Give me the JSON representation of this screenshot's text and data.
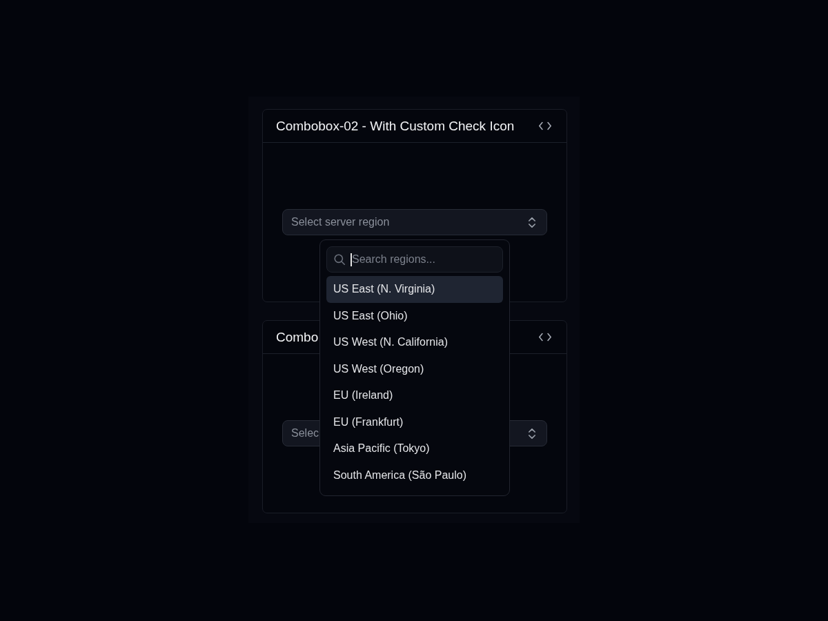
{
  "cards": [
    {
      "title": "Combobox-02 - With Custom Check Icon",
      "combobox": {
        "placeholder": "Select server region",
        "expanded": true,
        "search": {
          "placeholder": "Search regions...",
          "focused": true
        },
        "options": [
          {
            "label": "US East (N. Virginia)",
            "highlighted": true,
            "selected": false
          },
          {
            "label": "US East (Ohio)",
            "highlighted": false,
            "selected": false
          },
          {
            "label": "US West (N. California)",
            "highlighted": false,
            "selected": false
          },
          {
            "label": "US West (Oregon)",
            "highlighted": false,
            "selected": false
          },
          {
            "label": "EU (Ireland)",
            "highlighted": false,
            "selected": false
          },
          {
            "label": "EU (Frankfurt)",
            "highlighted": false,
            "selected": false
          },
          {
            "label": "Asia Pacific (Tokyo)",
            "highlighted": false,
            "selected": false
          },
          {
            "label": "South America (São Paulo)",
            "highlighted": false,
            "selected": false
          }
        ]
      }
    },
    {
      "title": "Combo",
      "combobox": {
        "placeholder": "Selec"
      }
    }
  ]
}
